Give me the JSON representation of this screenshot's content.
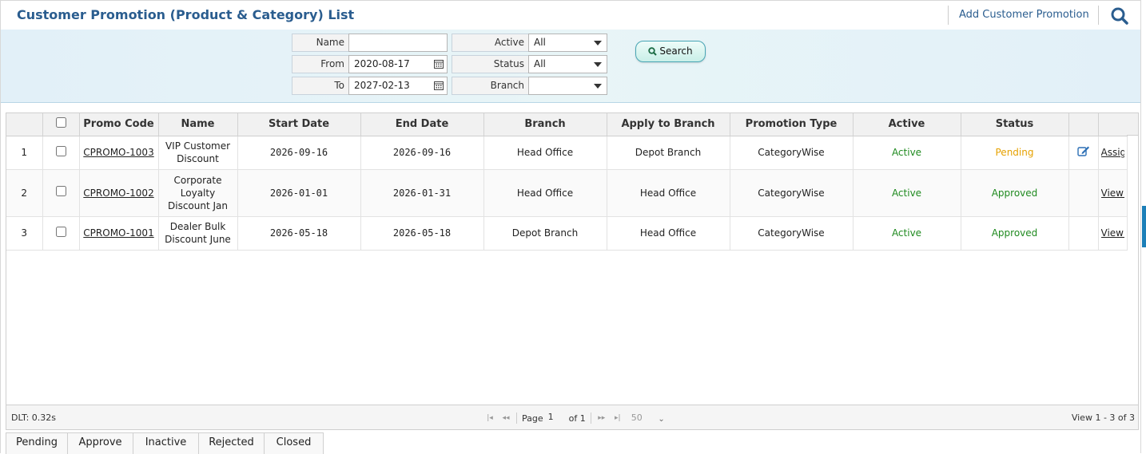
{
  "header": {
    "title": "Customer Promotion (Product & Category) List",
    "add_link": "Add Customer Promotion"
  },
  "filters": {
    "name_label": "Name",
    "name_value": "",
    "from_label": "From",
    "from_value": "2020-08-17",
    "to_label": "To",
    "to_value": "2027-02-13",
    "active_label": "Active",
    "active_value": "All",
    "status_label": "Status",
    "status_value": "All",
    "branch_label": "Branch",
    "branch_value": "",
    "search_label": "Search"
  },
  "grid": {
    "columns": [
      "Promo Code",
      "Name",
      "Start Date",
      "End Date",
      "Branch",
      "Apply to Branch",
      "Promotion Type",
      "Active",
      "Status"
    ],
    "rows": [
      {
        "num": "1",
        "code": "CPROMO-1003",
        "name": "VIP Customer Discount",
        "start": "2026-09-16",
        "end": "2026-09-16",
        "branch": "Head Office",
        "apply": "Depot Branch",
        "type": "CategoryWise",
        "active": "Active",
        "status": "Pending",
        "action": "Assign Cust"
      },
      {
        "num": "2",
        "code": "CPROMO-1002",
        "name": "Corporate Loyalty Discount Jan",
        "start": "2026-01-01",
        "end": "2026-01-31",
        "branch": "Head Office",
        "apply": "Head Office",
        "type": "CategoryWise",
        "active": "Active",
        "status": "Approved",
        "action": "View Cust"
      },
      {
        "num": "3",
        "code": "CPROMO-1001",
        "name": "Dealer Bulk Discount June",
        "start": "2026-05-18",
        "end": "2026-05-18",
        "branch": "Depot Branch",
        "apply": "Head Office",
        "type": "CategoryWise",
        "active": "Active",
        "status": "Approved",
        "action": "View Cust"
      }
    ]
  },
  "pager": {
    "dlt": "DLT: 0.32s",
    "page_label": "Page",
    "page_value": "1",
    "of_label": "of 1",
    "page_size": "50",
    "view_info": "View 1 - 3 of 3"
  },
  "tabs": [
    "Pending",
    "Approve",
    "Inactive",
    "Rejected",
    "Closed"
  ],
  "colors": {
    "title": "#2a5d8f",
    "active": "#1f8a1f",
    "pending": "#e6a100",
    "approved": "#1f8a1f"
  }
}
